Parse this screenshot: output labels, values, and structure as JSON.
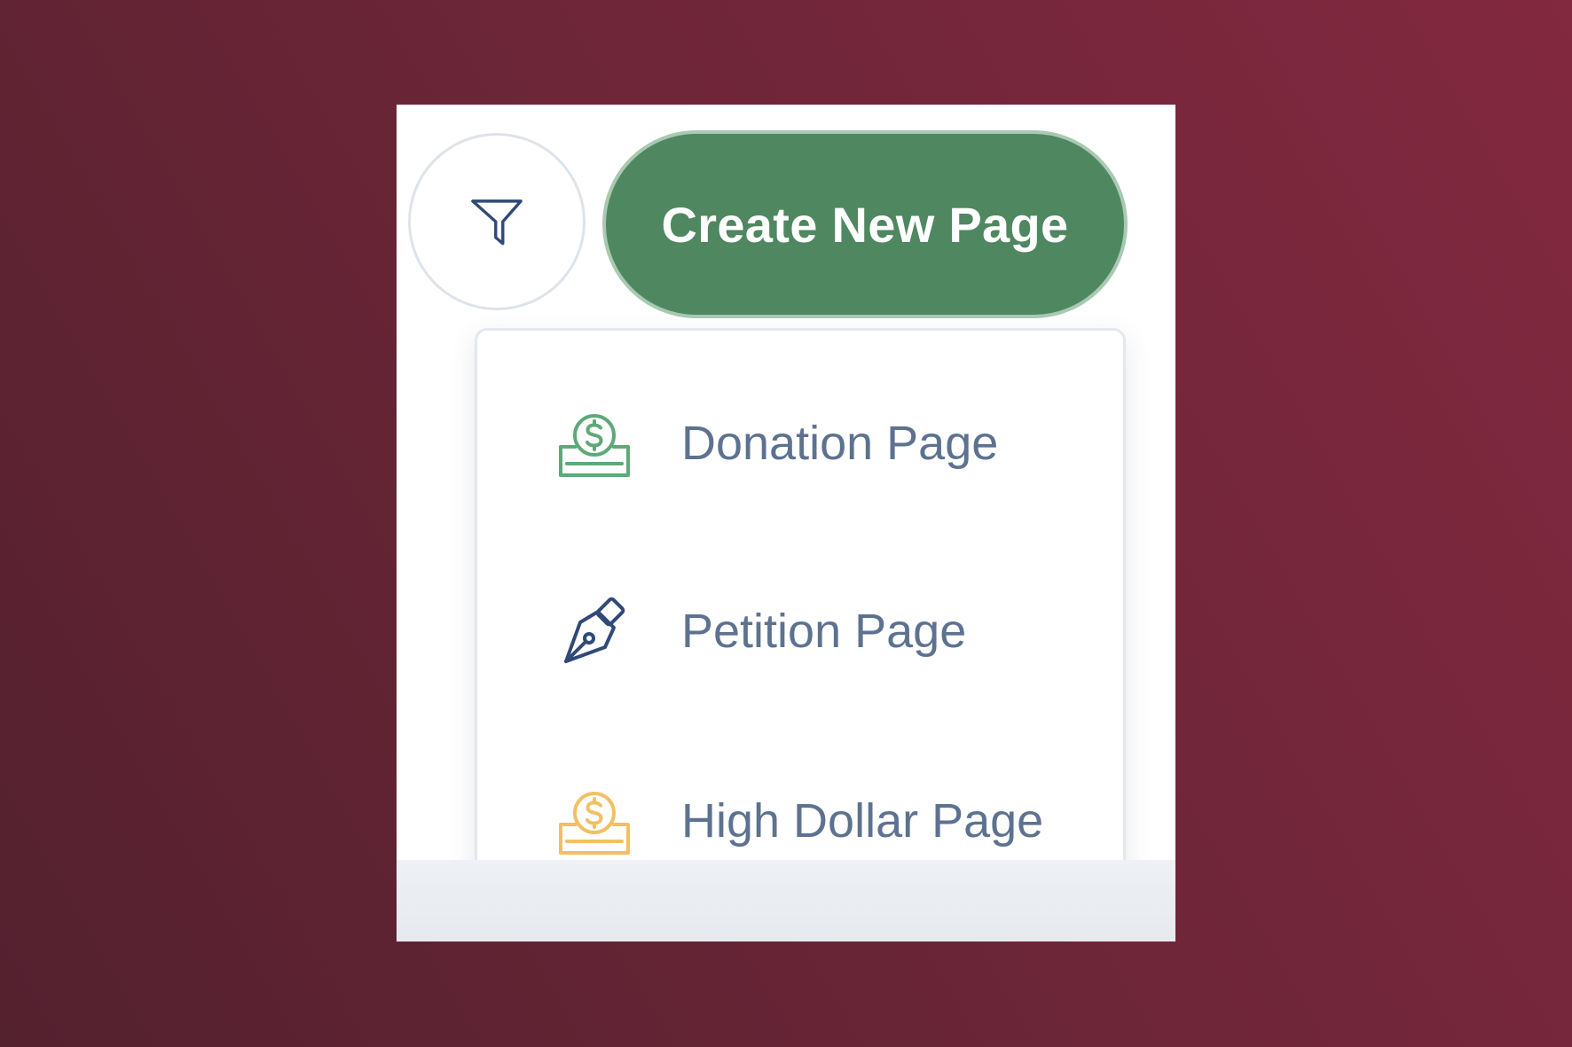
{
  "toolbar": {
    "filter_icon": "filter-funnel-icon",
    "create_button_label": "Create New Page"
  },
  "dropdown": {
    "items": [
      {
        "label": "Donation Page",
        "icon": "donation-coin-icon",
        "icon_color": "#5fa877"
      },
      {
        "label": "Petition Page",
        "icon": "fountain-pen-icon",
        "icon_color": "#2f4a78"
      },
      {
        "label": "High Dollar Page",
        "icon": "high-dollar-coin-icon",
        "icon_color": "#f2c063"
      }
    ]
  },
  "colors": {
    "primary_green": "#4e8760",
    "text_slate": "#5d7290",
    "background_maroon": "#6e2638"
  }
}
